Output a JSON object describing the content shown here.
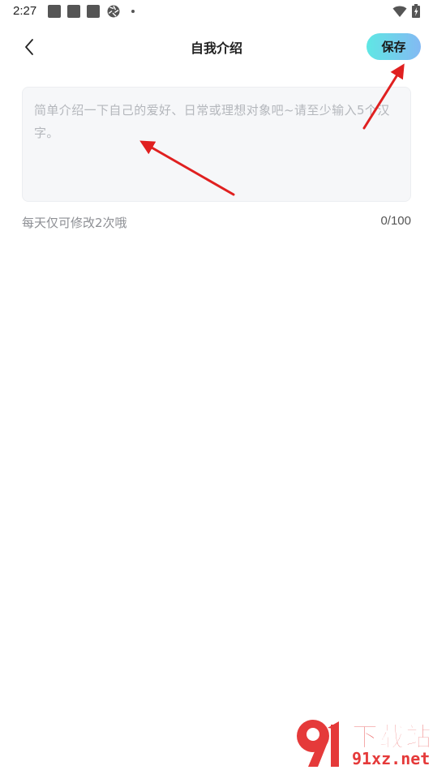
{
  "status_bar": {
    "time": "2:27",
    "icons": [
      "notification-square-icon",
      "notification-square-icon",
      "notification-square-icon",
      "aperture-icon",
      "dot-icon",
      "wifi-icon",
      "battery-icon"
    ]
  },
  "header": {
    "title": "自我介绍",
    "back_icon": "chevron-left-icon",
    "save_label": "保存",
    "save_gradient": [
      "#5fe7e4",
      "#83b9f3"
    ]
  },
  "intro": {
    "value": "",
    "placeholder": "简单介绍一下自己的爱好、日常或理想对象吧~请至少输入5个汉字。",
    "limit_note": "每天仅可修改2次哦",
    "char_count": "0/100"
  },
  "annotations": {
    "arrow_color": "#e02020",
    "count": 2
  },
  "watermark": {
    "title": "下载站",
    "domain": "91xz.net",
    "logo_text": "91",
    "color": "#e53a3a"
  }
}
